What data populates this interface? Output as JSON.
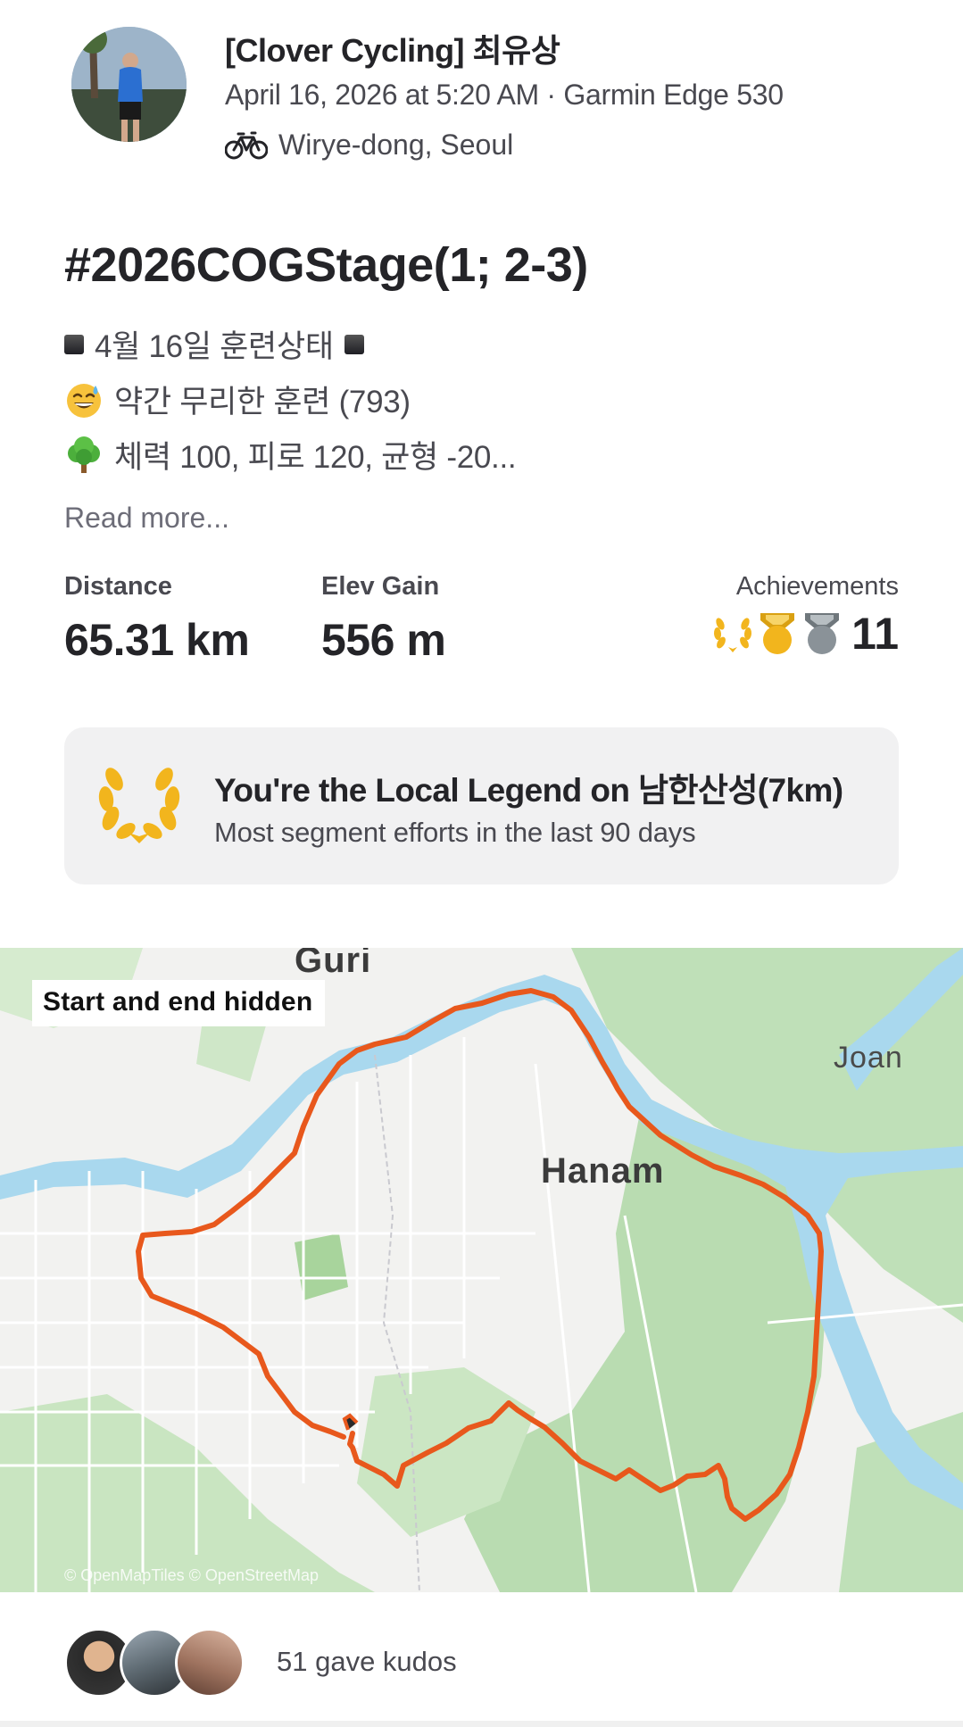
{
  "header": {
    "athlete_name": "[Clover Cycling] 최유상",
    "meta": "April 16, 2026 at 5:20 AM · Garmin Edge 530",
    "location": "Wirye-dong, Seoul",
    "activity_icon": "bike-icon"
  },
  "activity": {
    "title": "#2026COGStage(1; 2-3)",
    "description_lines": [
      "4월 16일 훈련상태",
      "약간 무리한 훈련 (793)",
      "체력 100, 피로 120, 균형 -20..."
    ],
    "read_more": "Read more..."
  },
  "stats": {
    "distance": {
      "label": "Distance",
      "value": "65.31 km"
    },
    "elev_gain": {
      "label": "Elev Gain",
      "value": "556 m"
    },
    "achievements": {
      "label": "Achievements",
      "count": "11",
      "icons": [
        "laurel-icon",
        "gold-medal-icon",
        "silver-medal-icon"
      ]
    }
  },
  "legend_card": {
    "title": "You're the Local Legend on 남한산성(7km)",
    "subtitle": "Most segment efforts in the last 90 days",
    "icon": "laurel-icon"
  },
  "map": {
    "chip": "Start and end hidden",
    "labels": {
      "guri": "Guri",
      "hanam": "Hanam",
      "joan": "Joan"
    },
    "attribution": "© OpenMapTiles © OpenStreetMap",
    "route_color": "#e8581c",
    "water_color": "#a9d8ee",
    "forest_color": "#bfe0b8"
  },
  "kudos": {
    "text": "51 gave kudos",
    "avatar_count": 3
  },
  "colors": {
    "gold": "#f2b51d",
    "silver": "#8a9298"
  }
}
